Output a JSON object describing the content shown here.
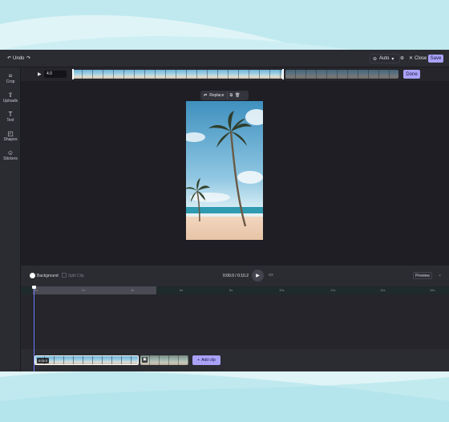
{
  "toolbar": {
    "undo_label": "Undo",
    "undo_icon": "undo-icon",
    "redo_icon": "redo-icon",
    "zoom_value": "Auto",
    "close_label": "Close",
    "save_label": "Save"
  },
  "sidebar": {
    "items": [
      {
        "label": "Crop",
        "icon": "crop-icon"
      },
      {
        "label": "Uploads",
        "icon": "upload-icon"
      },
      {
        "label": "Text",
        "icon": "text-icon"
      },
      {
        "label": "Shapes",
        "icon": "shapes-icon"
      },
      {
        "label": "Stickers",
        "icon": "sticker-icon"
      }
    ]
  },
  "trim": {
    "time_value": "4.0",
    "done_label": "Done"
  },
  "canvas_toolbar": {
    "replace_label": "Replace"
  },
  "controls": {
    "background_label": "Background",
    "split_clip_label": "Split Clip",
    "timecode": "0:00.0 / 0:10.2",
    "preview_label": "Preview"
  },
  "timeline": {
    "ruler_labels": [
      "0s",
      "2s",
      "4s",
      "6s",
      "8s",
      "10s",
      "12s",
      "14s",
      "16s"
    ],
    "clip_time": "0:05.0",
    "add_clip_label": "Add clip"
  },
  "colors": {
    "accent": "#a9a2f8",
    "app_bg": "#25252b",
    "playhead": "#6a7cff"
  }
}
